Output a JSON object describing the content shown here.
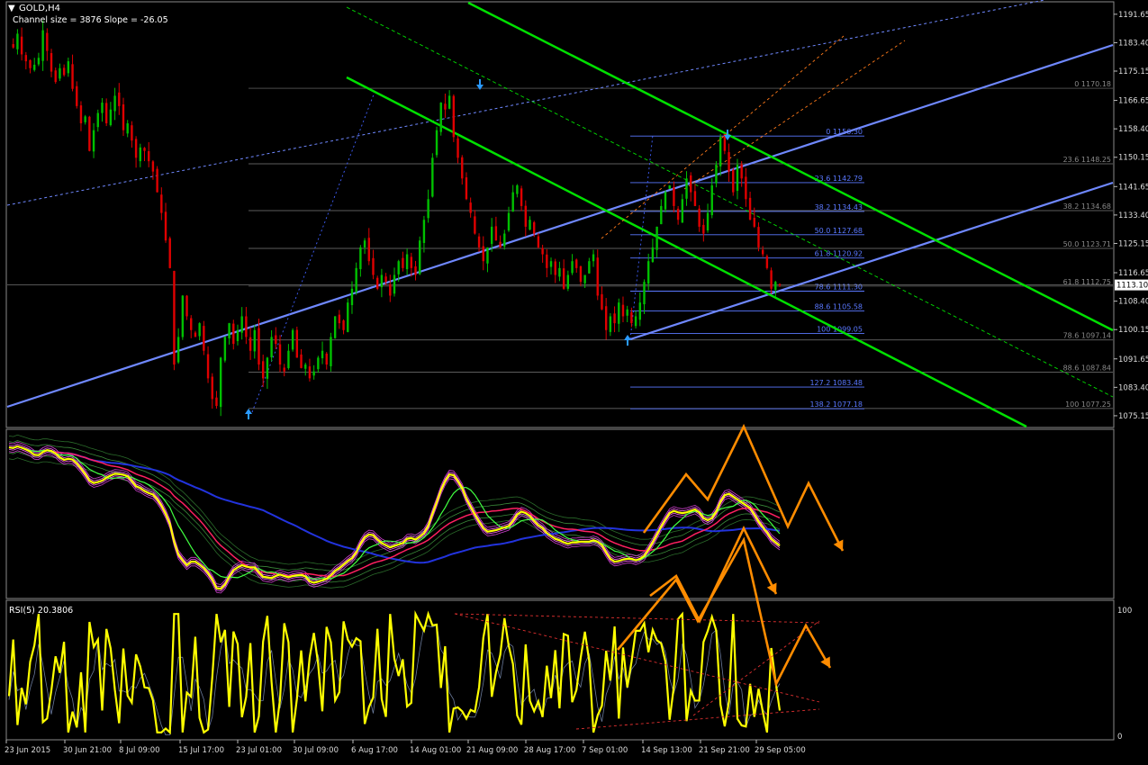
{
  "header": {
    "symbol": "GOLD,H4",
    "subtitle": "Channel size = 3876 Slope = -26.05"
  },
  "indicator_label": "RSI(5) 20.3806",
  "chart_data": [
    {
      "type": "candlestick",
      "title": "GOLD,H4",
      "ylim": [
        1072,
        1195
      ],
      "y_ticks": [
        "1191.65",
        "1183.40",
        "1175.15",
        "1166.65",
        "1158.40",
        "1150.15",
        "1141.65",
        "1133.40",
        "1125.15",
        "1116.65",
        "1108.40",
        "1100.15",
        "1091.65",
        "1083.40",
        "1075.15"
      ],
      "current_price": "1113.10",
      "fib_left": {
        "levels": [
          {
            "label": "0 1170.18",
            "y": 1170.18
          },
          {
            "label": "23.6 1148.25",
            "y": 1148.25
          },
          {
            "label": "38.2 1134.68",
            "y": 1134.68
          },
          {
            "label": "50.0 1123.71",
            "y": 1123.71
          },
          {
            "label": "61.8 1112.75",
            "y": 1112.75
          },
          {
            "label": "78.6 1097.14",
            "y": 1097.14
          },
          {
            "label": "88.6 1087.84",
            "y": 1087.84
          },
          {
            "label": "100 1077.25",
            "y": 1077.25
          }
        ]
      },
      "fib_right": {
        "levels": [
          {
            "label": "0 1156.30",
            "y": 1156.3
          },
          {
            "label": "23.6 1142.79",
            "y": 1142.79
          },
          {
            "label": "38.2 1134.43",
            "y": 1134.43
          },
          {
            "label": "50.0 1127.68",
            "y": 1127.68
          },
          {
            "label": "61.8 1120.92",
            "y": 1120.92
          },
          {
            "label": "78.6 1111.30",
            "y": 1111.3
          },
          {
            "label": "88.6 1105.58",
            "y": 1105.58
          },
          {
            "label": "100 1099.05",
            "y": 1099.05
          },
          {
            "label": "127.2 1083.48",
            "y": 1083.48
          },
          {
            "label": "138.2 1077.18",
            "y": 1077.18
          }
        ]
      },
      "close_series": [
        1183,
        1182,
        1186,
        1180,
        1178,
        1176,
        1177,
        1179,
        1187,
        1181,
        1175,
        1172,
        1176,
        1174,
        1178,
        1170,
        1165,
        1160,
        1162,
        1152,
        1158,
        1163,
        1166,
        1160,
        1164,
        1168,
        1165,
        1158,
        1160,
        1155,
        1150,
        1153,
        1152,
        1149,
        1146,
        1140,
        1134,
        1126,
        1118,
        1090,
        1098,
        1110,
        1104,
        1100,
        1098,
        1102,
        1094,
        1086,
        1080,
        1078,
        1092,
        1098,
        1102,
        1096,
        1100,
        1104,
        1098,
        1094,
        1100,
        1090,
        1086,
        1092,
        1098,
        1096,
        1090,
        1088,
        1094,
        1100,
        1092,
        1089,
        1090,
        1086,
        1088,
        1092,
        1094,
        1090,
        1098,
        1104,
        1102,
        1100,
        1108,
        1112,
        1118,
        1124,
        1126,
        1120,
        1116,
        1112,
        1116,
        1114,
        1110,
        1116,
        1120,
        1118,
        1122,
        1118,
        1116,
        1126,
        1132,
        1138,
        1150,
        1158,
        1166,
        1164,
        1168,
        1156,
        1150,
        1144,
        1138,
        1134,
        1128,
        1124,
        1120,
        1124,
        1130,
        1126,
        1124,
        1128,
        1134,
        1140,
        1142,
        1136,
        1130,
        1132,
        1128,
        1124,
        1122,
        1118,
        1120,
        1116,
        1118,
        1112,
        1116,
        1120,
        1118,
        1114,
        1116,
        1120,
        1122,
        1110,
        1106,
        1100,
        1104,
        1102,
        1108,
        1104,
        1106,
        1102,
        1104,
        1108,
        1114,
        1120,
        1124,
        1130,
        1136,
        1140,
        1142,
        1136,
        1132,
        1138,
        1144,
        1140,
        1136,
        1130,
        1128,
        1134,
        1142,
        1148,
        1156,
        1152,
        1146,
        1140,
        1148,
        1144,
        1138,
        1132,
        1130,
        1124,
        1122,
        1118,
        1112,
        1114,
        1113
      ]
    },
    {
      "type": "line",
      "title": "RSI(5) 20.3806",
      "ylim": [
        0,
        100
      ],
      "y_ticks": [
        "100",
        "0"
      ],
      "x_tick_labels": [
        "23 Jun 2015",
        "30 Jun 21:00",
        "8 Jul 09:00",
        "15 Jul 17:00",
        "23 Jul 01:00",
        "30 Jul 09:00",
        "6 Aug 17:00",
        "14 Aug 01:00",
        "21 Aug 09:00",
        "28 Aug 17:00",
        "7 Sep 01:00",
        "14 Sep 13:00",
        "21 Sep 21:00",
        "29 Sep 05:00"
      ],
      "last_value": 20.3806
    }
  ],
  "colors": {
    "bull_candle": "#00c000",
    "bear_candle": "#e00000",
    "channel": "#00e000",
    "regression": "#6f88ff",
    "arrows": "#ff8c00",
    "rsi": "#ffff00",
    "fib": "#5a78ff",
    "grid": "#7a7a7a"
  }
}
